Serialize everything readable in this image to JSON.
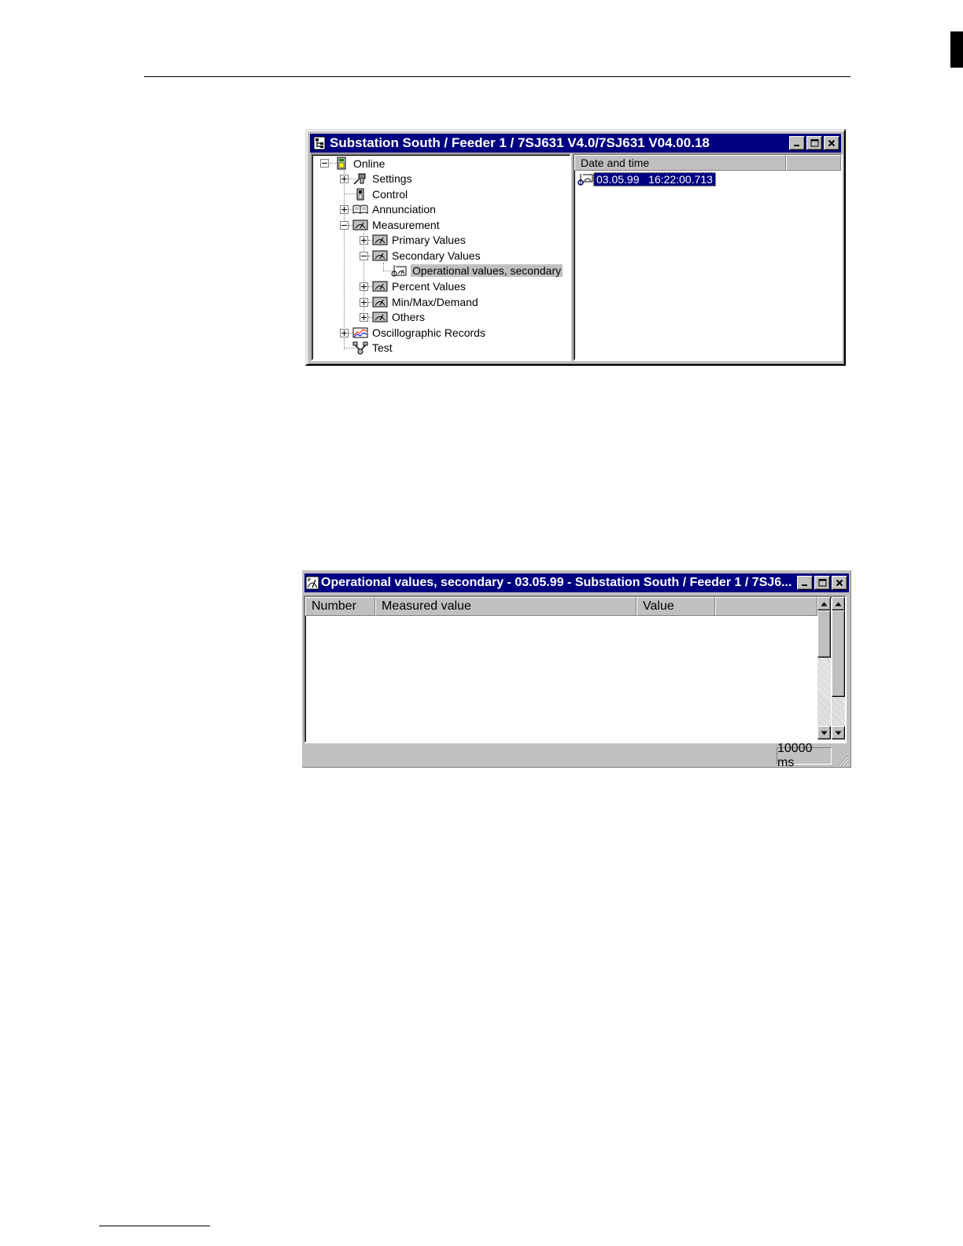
{
  "tree_window": {
    "title": "Substation South / Feeder 1 / 7SJ631 V4.0/7SJ631 V04.00.18",
    "tree": {
      "online": "Online",
      "settings": "Settings",
      "control": "Control",
      "annunciation": "Annunciation",
      "measurement": "Measurement",
      "primary_values": "Primary Values",
      "secondary_values": "Secondary Values",
      "operational_values_secondary": "Operational values, secondary",
      "percent_values": "Percent Values",
      "min_max_demand": "Min/Max/Demand",
      "others": "Others",
      "oscillographic_records": "Oscillographic Records",
      "test": "Test"
    },
    "list": {
      "column_date_time": "Date and time",
      "rows": [
        {
          "date": "03.05.99",
          "time": "16:22:00.713"
        }
      ]
    }
  },
  "values_window": {
    "title": "Operational values, secondary - 03.05.99 - Substation South / Feeder 1 / 7SJ6...",
    "columns": {
      "number": "Number",
      "measured_value": "Measured value",
      "value": "Value"
    },
    "status": {
      "interval": "10000 ms"
    }
  },
  "icons": {
    "minimize": "minimize-icon",
    "maximize": "maximize-icon",
    "close": "close-icon",
    "scroll_up": "scroll-up-arrow",
    "scroll_down": "scroll-down-arrow"
  }
}
